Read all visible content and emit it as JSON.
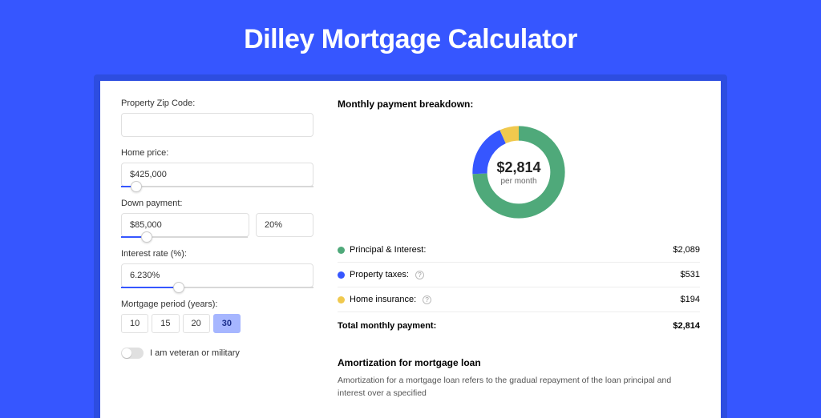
{
  "title": "Dilley Mortgage Calculator",
  "form": {
    "zip_label": "Property Zip Code:",
    "zip_value": "",
    "home_price_label": "Home price:",
    "home_price_value": "$425,000",
    "home_price_slider_pct": 8,
    "down_payment_label": "Down payment:",
    "down_payment_value": "$85,000",
    "down_payment_pct_value": "20%",
    "down_payment_slider_pct": 20,
    "interest_label": "Interest rate (%):",
    "interest_value": "6.230%",
    "interest_slider_pct": 30,
    "period_label": "Mortgage period (years):",
    "periods": [
      "10",
      "15",
      "20",
      "30"
    ],
    "period_active": "30",
    "veteran_label": "I am veteran or military"
  },
  "breakdown": {
    "title": "Monthly payment breakdown:",
    "donut_amount": "$2,814",
    "donut_sub": "per month",
    "items": [
      {
        "label": "Principal & Interest:",
        "value": "$2,089",
        "color": "#4fa97a",
        "help": false
      },
      {
        "label": "Property taxes:",
        "value": "$531",
        "color": "#3656ff",
        "help": true
      },
      {
        "label": "Home insurance:",
        "value": "$194",
        "color": "#f0c94e",
        "help": true
      }
    ],
    "total_label": "Total monthly payment:",
    "total_value": "$2,814"
  },
  "chart_data": {
    "type": "pie",
    "title": "Monthly payment breakdown",
    "series": [
      {
        "name": "Principal & Interest",
        "value": 2089,
        "color": "#4fa97a"
      },
      {
        "name": "Property taxes",
        "value": 531,
        "color": "#3656ff"
      },
      {
        "name": "Home insurance",
        "value": 194,
        "color": "#f0c94e"
      }
    ],
    "total": 2814
  },
  "amortization": {
    "title": "Amortization for mortgage loan",
    "body": "Amortization for a mortgage loan refers to the gradual repayment of the loan principal and interest over a specified"
  }
}
